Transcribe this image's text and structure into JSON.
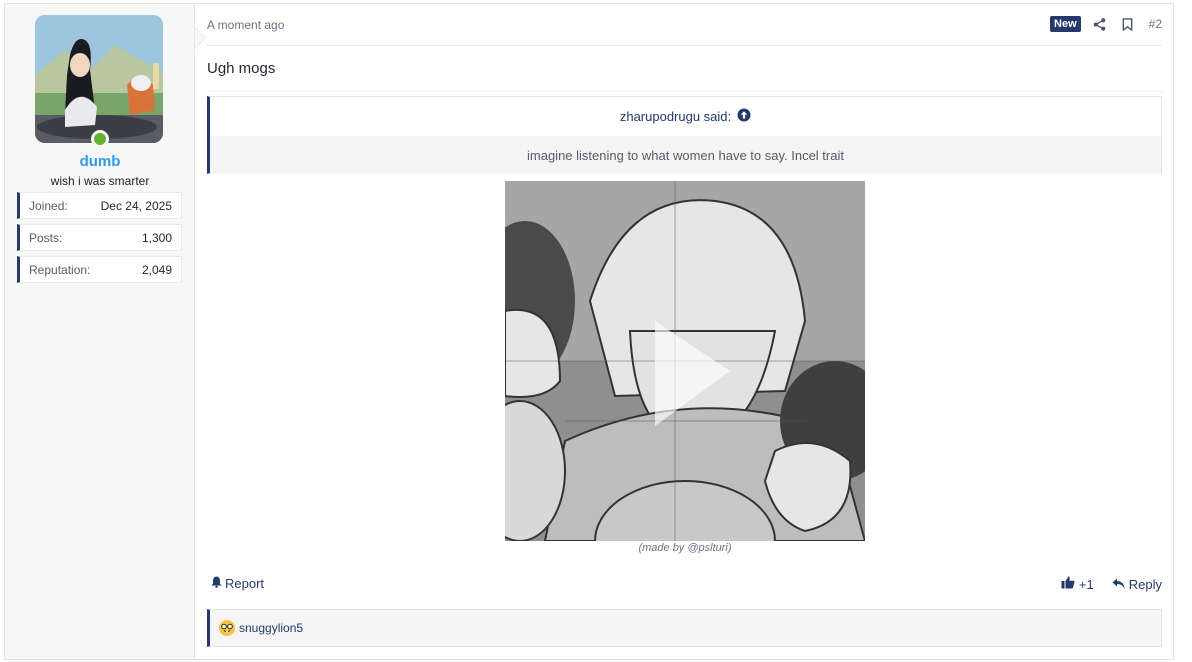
{
  "user": {
    "name": "dumb",
    "title": "wish i was smarter",
    "stats": [
      {
        "label": "Joined:",
        "value": "Dec 24, 2025"
      },
      {
        "label": "Posts:",
        "value": "1,300"
      },
      {
        "label": "Reputation:",
        "value": "2,049"
      }
    ],
    "online_color": "#63b32e"
  },
  "post": {
    "time": "A moment ago",
    "badge": "New",
    "number": "#2",
    "message": "Ugh mogs",
    "quote": {
      "author": "zharupodrugu said:",
      "text": "imagine listening to what women have to say. Incel trait"
    },
    "media_caption": "(made by @pslturi)",
    "actions": {
      "report": "Report",
      "like_count": "+1",
      "reply": "Reply"
    },
    "reactions": {
      "users": "snuggylion5",
      "emoji": "nerd-face-icon"
    }
  },
  "colors": {
    "accent": "#243a6e",
    "username": "#2f9be0"
  }
}
